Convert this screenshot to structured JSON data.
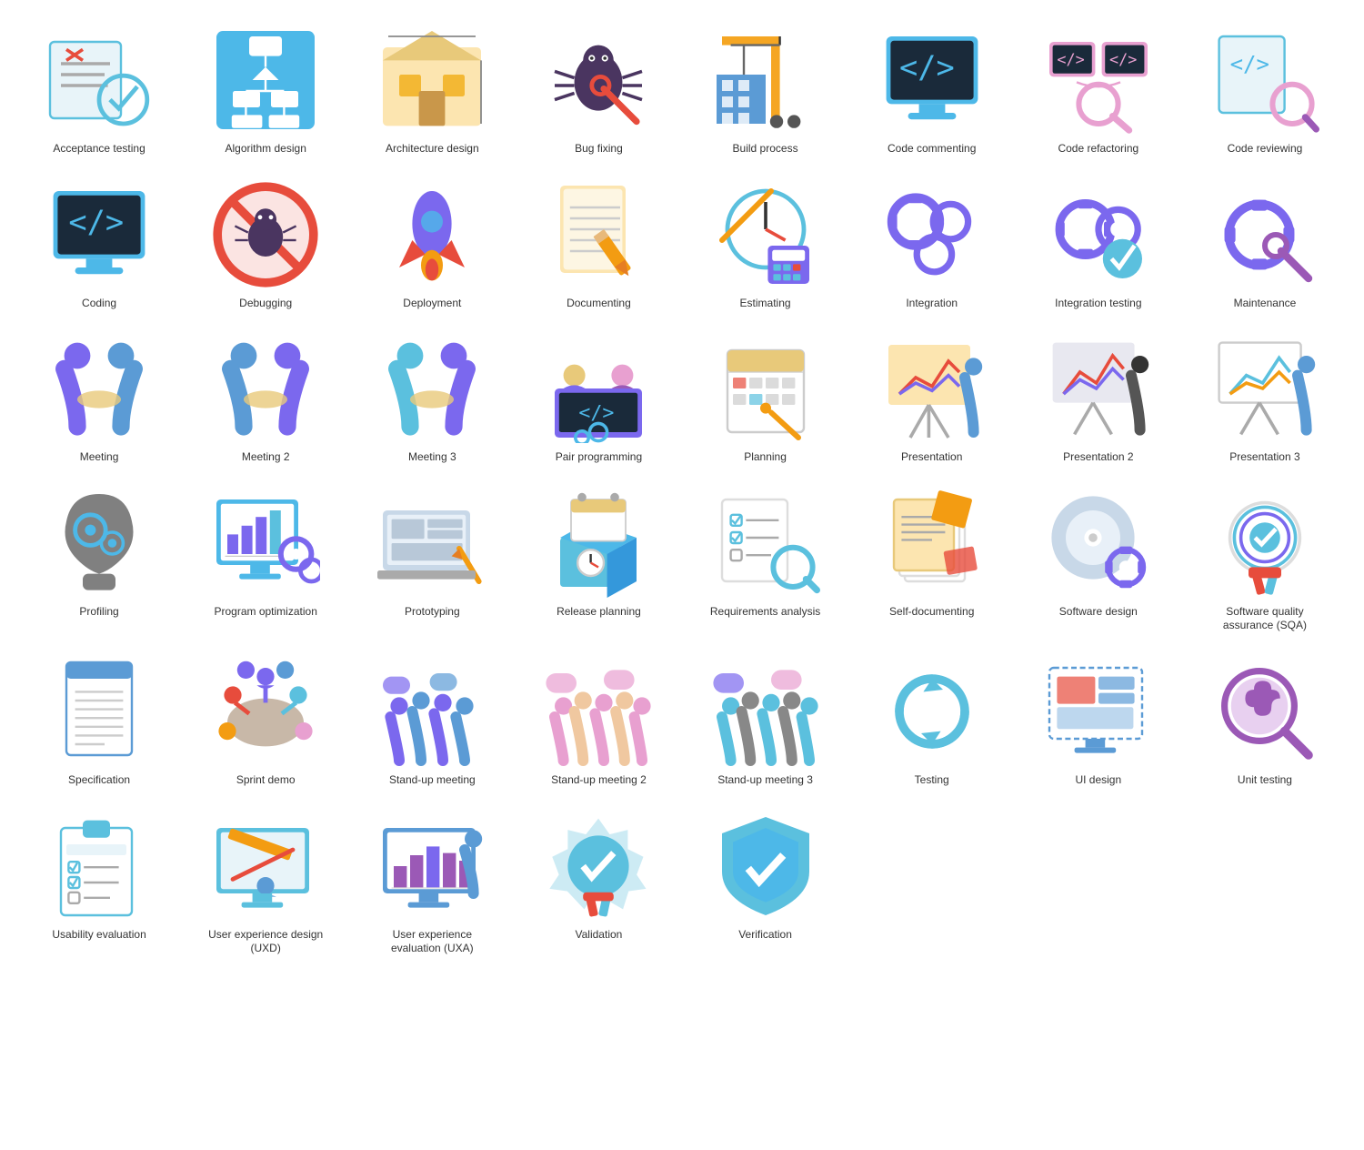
{
  "items": [
    {
      "id": "acceptance-testing",
      "label": "Acceptance testing"
    },
    {
      "id": "algorithm-design",
      "label": "Algorithm design"
    },
    {
      "id": "architecture-design",
      "label": "Architecture design"
    },
    {
      "id": "bug-fixing",
      "label": "Bug fixing"
    },
    {
      "id": "build-process",
      "label": "Build process"
    },
    {
      "id": "code-commenting",
      "label": "Code commenting"
    },
    {
      "id": "code-refactoring",
      "label": "Code refactoring"
    },
    {
      "id": "code-reviewing",
      "label": "Code reviewing"
    },
    {
      "id": "coding",
      "label": "Coding"
    },
    {
      "id": "debugging",
      "label": "Debugging"
    },
    {
      "id": "deployment",
      "label": "Deployment"
    },
    {
      "id": "documenting",
      "label": "Documenting"
    },
    {
      "id": "estimating",
      "label": "Estimating"
    },
    {
      "id": "integration",
      "label": "Integration"
    },
    {
      "id": "integration-testing",
      "label": "Integration testing"
    },
    {
      "id": "maintenance",
      "label": "Maintenance"
    },
    {
      "id": "meeting",
      "label": "Meeting"
    },
    {
      "id": "meeting-2",
      "label": "Meeting 2"
    },
    {
      "id": "meeting-3",
      "label": "Meeting 3"
    },
    {
      "id": "pair-programming",
      "label": "Pair programming"
    },
    {
      "id": "planning",
      "label": "Planning"
    },
    {
      "id": "presentation",
      "label": "Presentation"
    },
    {
      "id": "presentation-2",
      "label": "Presentation 2"
    },
    {
      "id": "presentation-3",
      "label": "Presentation 3"
    },
    {
      "id": "profiling",
      "label": "Profiling"
    },
    {
      "id": "program-optimization",
      "label": "Program optimization"
    },
    {
      "id": "prototyping",
      "label": "Prototyping"
    },
    {
      "id": "release-planning",
      "label": "Release planning"
    },
    {
      "id": "requirements-analysis",
      "label": "Requirements analysis"
    },
    {
      "id": "self-documenting",
      "label": "Self-documenting"
    },
    {
      "id": "software-design",
      "label": "Software design"
    },
    {
      "id": "software-quality",
      "label": "Software quality assurance (SQA)"
    },
    {
      "id": "specification",
      "label": "Specification"
    },
    {
      "id": "sprint-demo",
      "label": "Sprint demo"
    },
    {
      "id": "standup-meeting",
      "label": "Stand-up meeting"
    },
    {
      "id": "standup-meeting-2",
      "label": "Stand-up meeting 2"
    },
    {
      "id": "standup-meeting-3",
      "label": "Stand-up meeting 3"
    },
    {
      "id": "testing",
      "label": "Testing"
    },
    {
      "id": "ui-design",
      "label": "UI design"
    },
    {
      "id": "unit-testing",
      "label": "Unit testing"
    },
    {
      "id": "usability-evaluation",
      "label": "Usability evaluation"
    },
    {
      "id": "uxd",
      "label": "User experience design (UXD)"
    },
    {
      "id": "uxa",
      "label": "User experience evaluation (UXA)"
    },
    {
      "id": "validation",
      "label": "Validation"
    },
    {
      "id": "verification",
      "label": "Verification"
    }
  ]
}
